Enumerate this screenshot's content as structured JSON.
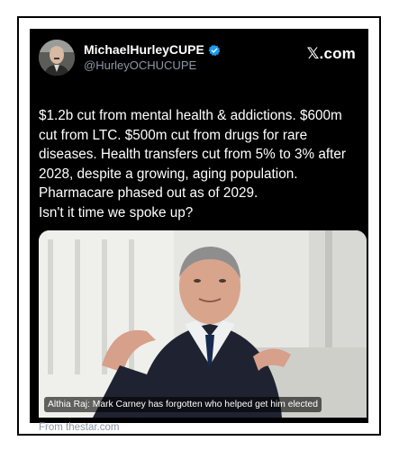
{
  "author": {
    "display_name": "MichaelHurleyCUPE",
    "handle": "@HurleyOCHUCUPE",
    "verified_icon": "verified-badge-icon",
    "verified_color": "#1d9bf0"
  },
  "brand": {
    "label": "𝕏.com"
  },
  "post": {
    "lines": [
      "$1.2b cut from mental health & addictions. $600m cut from LTC. $500m cut from drugs for rare diseases. Health transfers cut from 5% to 3% after 2028, despite a growing, aging population. Pharmacare phased out as of 2029.",
      "Isn't it time we spoke up?"
    ]
  },
  "media": {
    "caption": "Althia Raj: Mark Carney has forgotten who helped get him elected",
    "source": "From thestar.com"
  }
}
